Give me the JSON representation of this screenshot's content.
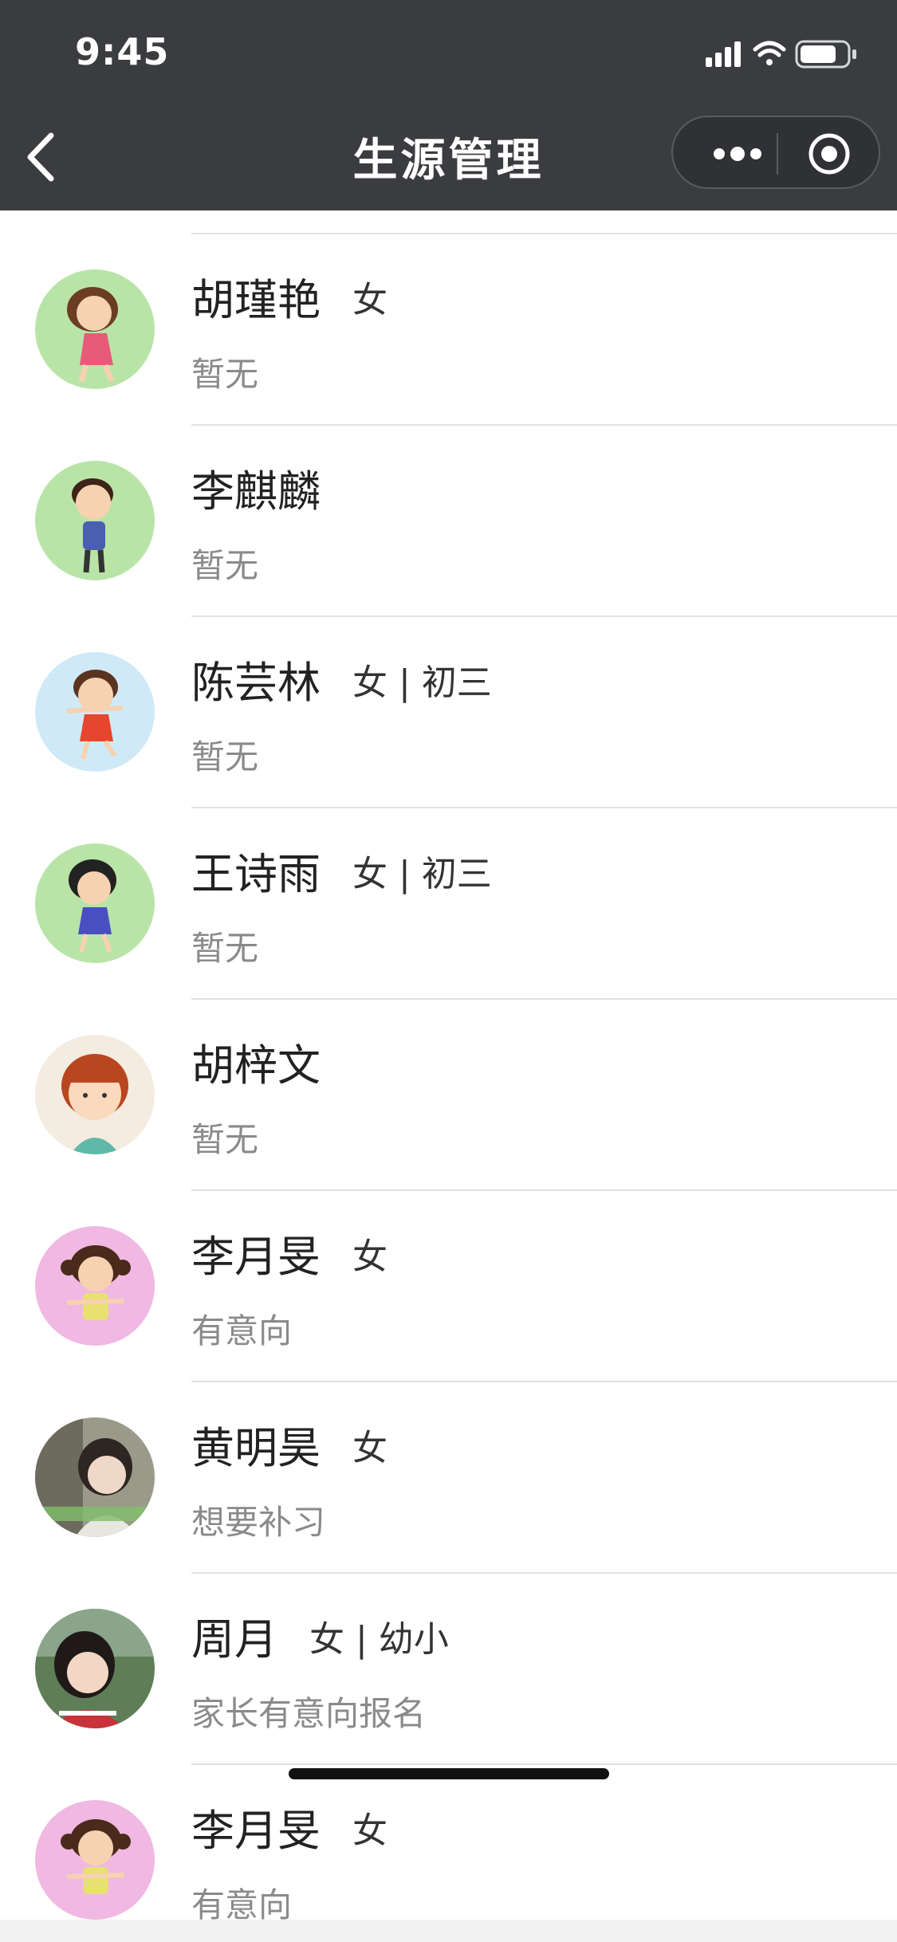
{
  "status_bar": {
    "time": "9:45"
  },
  "nav": {
    "title": "生源管理"
  },
  "students": [
    {
      "name": "胡瑾艳",
      "meta": "女",
      "note": "暂无",
      "avatar_icon": "cartoon-girl-icon",
      "avatar_bg": "#b9e4a8"
    },
    {
      "name": "李麒麟",
      "meta": "",
      "note": "暂无",
      "avatar_icon": "cartoon-boy-icon",
      "avatar_bg": "#b9e4a8"
    },
    {
      "name": "陈芸林",
      "meta": "女 | 初三",
      "note": "暂无",
      "avatar_icon": "cartoon-girl-icon",
      "avatar_bg": "#cfeaf6"
    },
    {
      "name": "王诗雨",
      "meta": "女 | 初三",
      "note": "暂无",
      "avatar_icon": "cartoon-girl-icon",
      "avatar_bg": "#b9e4a8"
    },
    {
      "name": "胡梓文",
      "meta": "",
      "note": "暂无",
      "avatar_icon": "cartoon-girl-icon",
      "avatar_bg": "#f4ece0"
    },
    {
      "name": "李月旻",
      "meta": "女",
      "note": "有意向",
      "avatar_icon": "cartoon-girl-icon",
      "avatar_bg": "#f0b8e2"
    },
    {
      "name": "黄明昊",
      "meta": "女",
      "note": "想要补习",
      "avatar_icon": "child-photo-icon",
      "avatar_bg": "#9a9a8a"
    },
    {
      "name": "周月",
      "meta": "女 | 幼小",
      "note": "家长有意向报名",
      "avatar_icon": "child-photo-icon",
      "avatar_bg": "#5f7d57"
    },
    {
      "name": "李月旻",
      "meta": "女",
      "note": "有意向",
      "avatar_icon": "cartoon-girl-icon",
      "avatar_bg": "#f0b8e2"
    }
  ]
}
